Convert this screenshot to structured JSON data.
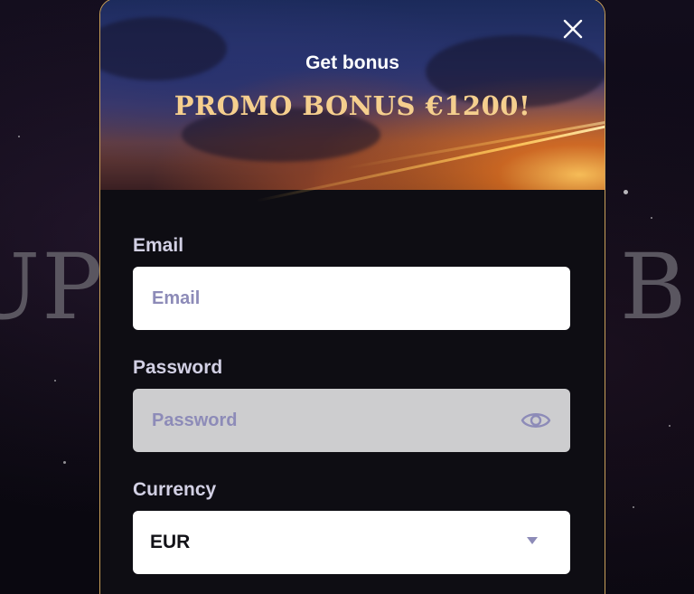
{
  "background": {
    "left_word": "UP",
    "right_word": "BO"
  },
  "modal": {
    "subtitle": "Get bonus",
    "title": "PROMO BONUS €1200!",
    "close_icon": "close-icon",
    "accent_color": "#c9a05a"
  },
  "form": {
    "email": {
      "label": "Email",
      "placeholder": "Email",
      "value": ""
    },
    "password": {
      "label": "Password",
      "placeholder": "Password",
      "value": "",
      "toggle_icon": "eye-icon"
    },
    "currency": {
      "label": "Currency",
      "selected": "EUR",
      "caret_icon": "caret-down-icon"
    }
  }
}
